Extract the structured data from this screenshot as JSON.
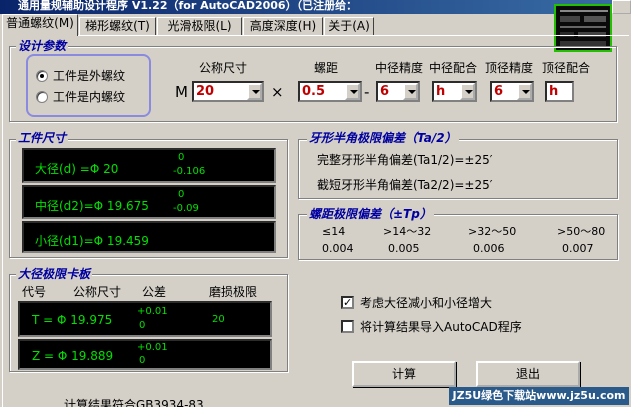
{
  "window": {
    "title": "通用量规辅助设计程序 V1.22（for AutoCAD2006）（已注册给："
  },
  "tabs": [
    {
      "label": "普通螺纹(M)"
    },
    {
      "label": "梯形螺纹(T)"
    },
    {
      "label": "光滑极限(L)"
    },
    {
      "label": "高度深度(H)"
    },
    {
      "label": "关于(A)"
    }
  ],
  "design_params": {
    "title": "设计参数",
    "radio_external": "工件是外螺纹",
    "radio_internal": "工件是内螺纹",
    "prefix": "M",
    "times": "×",
    "dash": "-",
    "labels": {
      "nominal": "公称尺寸",
      "pitch": "螺距",
      "pd_grade": "中径精度",
      "pd_fit": "中径配合",
      "td_grade": "顶径精度",
      "td_fit": "顶径配合"
    },
    "values": {
      "nominal": "20",
      "pitch": "0.5",
      "pd_grade": "6",
      "pd_fit": "h",
      "td_grade": "6",
      "td_fit": "h"
    }
  },
  "workpiece": {
    "title": "工件尺寸",
    "major": {
      "label": "大径(d) =Φ 20",
      "upper": "0",
      "lower": "-0.106"
    },
    "pitch": {
      "label": "中径(d2)=Φ 19.675",
      "upper": "0",
      "lower": "-0.09"
    },
    "minor": {
      "label": "小径(d1)=Φ 19.459"
    }
  },
  "angle_dev": {
    "title": "牙形半角极限偏差（Ta/2）",
    "full": "完整牙形半角偏差(Ta1/2)=±25′",
    "trunc": "截短牙形半角偏差(Ta2/2)=±25′"
  },
  "pitch_dev": {
    "title": "螺距极限偏差（±Tp）",
    "headers": [
      "≤14",
      ">14～32",
      ">32～50",
      ">50～80"
    ],
    "values": [
      "0.004",
      "0.005",
      "0.006",
      "0.007"
    ]
  },
  "gauge": {
    "title": "大径极限卡板",
    "headers": {
      "code": "代号",
      "nominal": "公称尺寸",
      "tol": "公差",
      "wear": "磨损极限"
    },
    "T": {
      "label": "T = Φ 19.975",
      "upper": "+0.01",
      "lower": "0",
      "wear": "20"
    },
    "Z": {
      "label": "Z = Φ 19.889",
      "upper": "+0.01",
      "lower": "0"
    }
  },
  "options": {
    "consider": "考虑大径减小和小径增大",
    "export": "将计算结果导入AutoCAD程序"
  },
  "buttons": {
    "calc": "计算",
    "exit": "退出"
  },
  "footer": "计算结果符合GB3934-83",
  "watermark": "JZ5U绿色下载站www.jz5u.com"
}
